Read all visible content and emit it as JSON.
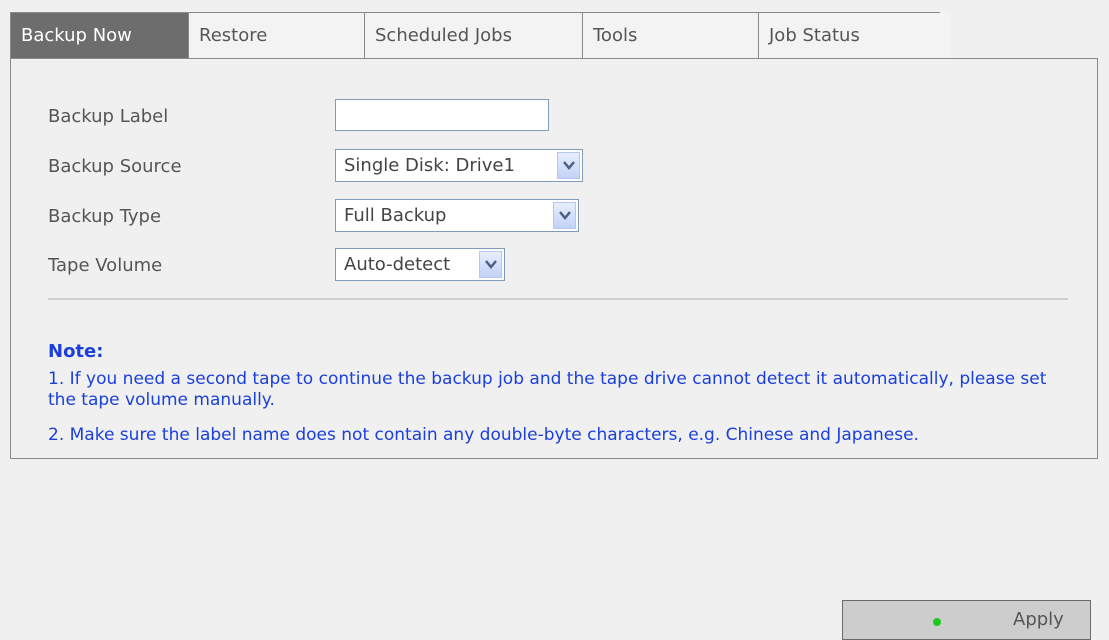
{
  "tabs": [
    {
      "label": "Backup Now",
      "active": true
    },
    {
      "label": "Restore"
    },
    {
      "label": "Scheduled Jobs"
    },
    {
      "label": "Tools"
    },
    {
      "label": "Job Status"
    },
    {
      "label": ""
    }
  ],
  "form": {
    "backup_label": {
      "label": "Backup Label",
      "value": ""
    },
    "backup_source": {
      "label": "Backup Source",
      "value": "Single Disk: Drive1"
    },
    "backup_type": {
      "label": "Backup Type",
      "value": "Full Backup"
    },
    "tape_volume": {
      "label": "Tape Volume",
      "value": "Auto-detect"
    }
  },
  "note": {
    "title": "Note:",
    "items": [
      "1. If you need a second tape to continue the backup job and the tape drive cannot detect it automatically, please set the tape volume manually.",
      "2. Make sure the label name does not contain any double-byte characters, e.g. Chinese and Japanese."
    ]
  },
  "apply_button": {
    "label": "Apply",
    "status_color": "#1ec81e"
  },
  "colors": {
    "active_tab": "#6d6d6d",
    "note_text": "#1a3fdc",
    "background": "#f0f0f0"
  }
}
